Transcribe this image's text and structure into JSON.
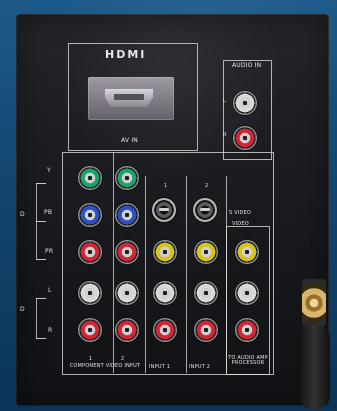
{
  "panel": {
    "hdmi_label": "HDMI",
    "av_in_label": "AV IN",
    "audio_in_label": "AUDIO IN",
    "audio_l": "L",
    "audio_r": "R",
    "component_labels": [
      "Y",
      "PB",
      "PR"
    ],
    "component_short": [
      "Y",
      "Pb",
      "Pr"
    ],
    "left_audio_labels": [
      "L",
      "R"
    ],
    "svideo_label_1": "S VIDEO",
    "svideo_label_2": "VIDEO",
    "input1_number": "1",
    "input2_number": "2",
    "bottom_labels": [
      "COMPONENT VIDEO INPUT",
      "INPUT 1",
      "INPUT 2",
      "TO AUDIO AMP PROCESSOR"
    ],
    "bottom_sub_1": "1",
    "bottom_sub_2": "2",
    "left_marks": [
      "D",
      "D"
    ]
  },
  "colors": {
    "green": "#1aa36b",
    "blue": "#2d4fc4",
    "red": "#d22638",
    "white": "#d8d8d8",
    "yellow": "#d7c21a"
  }
}
